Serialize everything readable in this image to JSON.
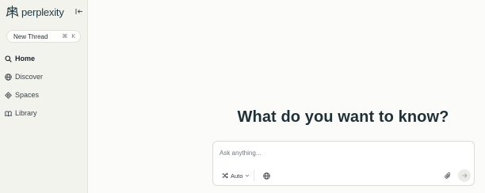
{
  "brand": {
    "name": "perplexity",
    "accent": "#1f3a44"
  },
  "sidebar": {
    "new_thread_label": "New Thread",
    "new_thread_shortcut": [
      "⌘",
      "K"
    ],
    "items": [
      {
        "label": "Home",
        "icon": "search-icon",
        "active": true
      },
      {
        "label": "Discover",
        "icon": "globe-icon",
        "active": false
      },
      {
        "label": "Spaces",
        "icon": "spaces-icon",
        "active": false
      },
      {
        "label": "Library",
        "icon": "library-icon",
        "active": false
      }
    ]
  },
  "main": {
    "headline": "What do you want to know?",
    "ask": {
      "placeholder": "Ask anything...",
      "mode_label": "Auto"
    }
  }
}
